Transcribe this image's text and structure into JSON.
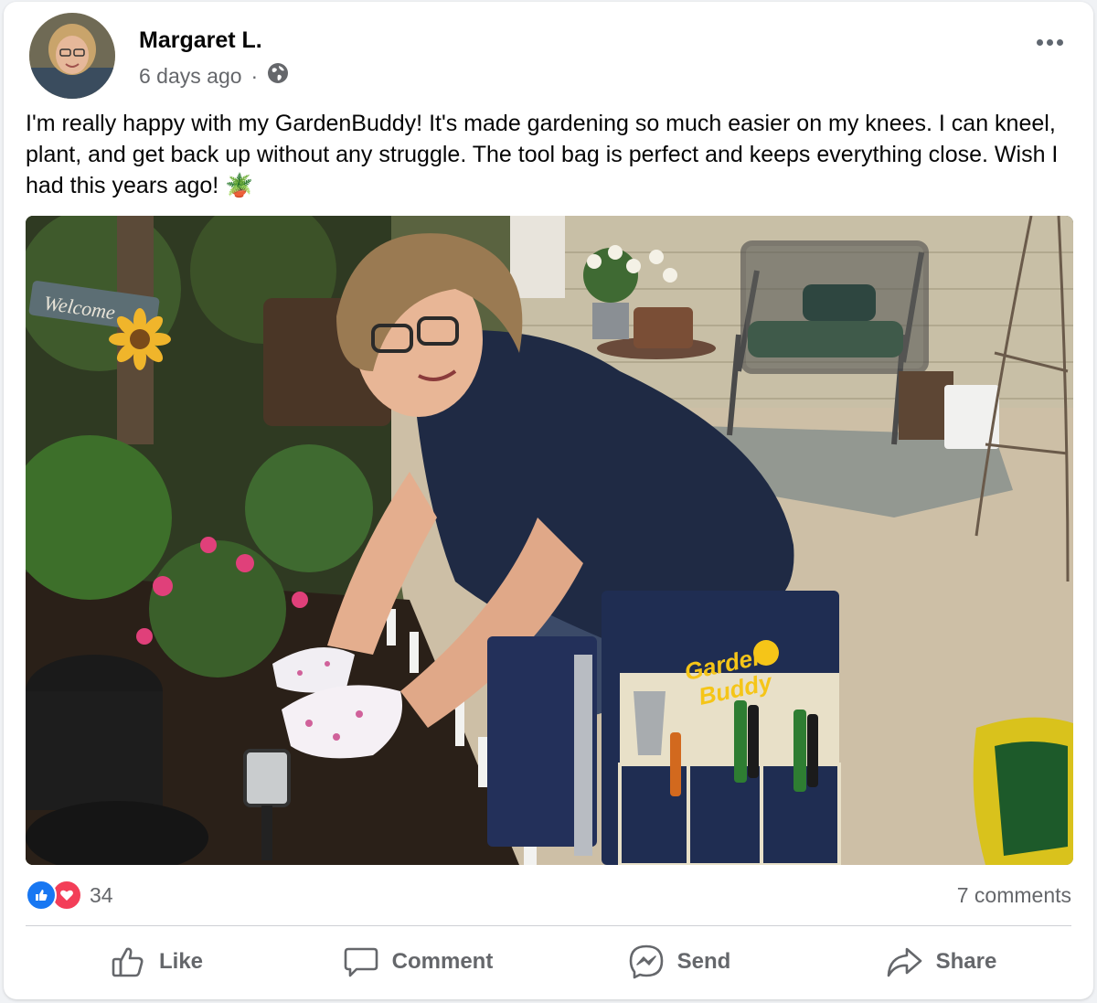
{
  "post": {
    "author": "Margaret L.",
    "timestamp": "6 days ago",
    "separator": "·",
    "audience_icon": "globe-icon",
    "more_icon": "more-options-icon",
    "text": "I'm really happy with my GardenBuddy! It's made gardening so much easier on my knees. I can kneel, plant, and get back up without any struggle. The tool bag is perfect and keeps everything close. Wish I had this years ago! 🪴",
    "photo": {
      "sign_text": "Welcome",
      "brand_text_line1": "Garden",
      "brand_text_line2": "Buddy"
    }
  },
  "stats": {
    "reaction_icons": [
      "like-reaction-icon",
      "love-reaction-icon"
    ],
    "reaction_count": "34",
    "comments": "7 comments"
  },
  "actions": [
    {
      "label": "Like",
      "icon": "thumbs-up-icon"
    },
    {
      "label": "Comment",
      "icon": "comment-icon"
    },
    {
      "label": "Send",
      "icon": "messenger-icon"
    },
    {
      "label": "Share",
      "icon": "share-icon"
    }
  ],
  "colors": {
    "like_blue": "#1877f2",
    "love_red": "#f33e58",
    "secondary_text": "#65676b",
    "brand_yellow": "#f5c518",
    "seat_navy": "#1f2d52"
  }
}
